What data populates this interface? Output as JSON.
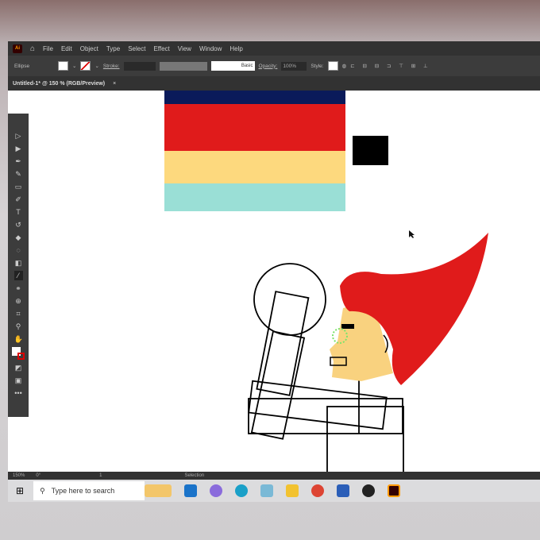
{
  "app": {
    "logo": "Ai",
    "menu": [
      "File",
      "Edit",
      "Object",
      "Type",
      "Select",
      "Effect",
      "View",
      "Window",
      "Help"
    ]
  },
  "control": {
    "selection_type": "Ellipse",
    "stroke_label": "Stroke:",
    "brush": "Basic",
    "opacity_label": "Opacity:",
    "opacity": "100%",
    "style_label": "Style:"
  },
  "document_tab": {
    "title": "Untitled-1* @ 150 % (RGB/Preview)",
    "close": "×"
  },
  "status": {
    "zoom": "150%",
    "rotation": "0°",
    "artboard": "1",
    "tool": "Selection"
  },
  "taskbar": {
    "search_placeholder": "Type here to search"
  },
  "colors": {
    "navy": "#0a1a5a",
    "red": "#e01b1b",
    "yellow": "#fdd97e",
    "teal": "#9adfd6",
    "skin": "#f9d27f"
  },
  "tools": [
    "selection",
    "direct-selection",
    "pen",
    "curvature",
    "rectangle",
    "paintbrush",
    "type",
    "rotate",
    "eraser",
    "lasso",
    "gradient",
    "eyedropper",
    "blend",
    "shape-builder",
    "artboard",
    "zoom",
    "hand"
  ]
}
